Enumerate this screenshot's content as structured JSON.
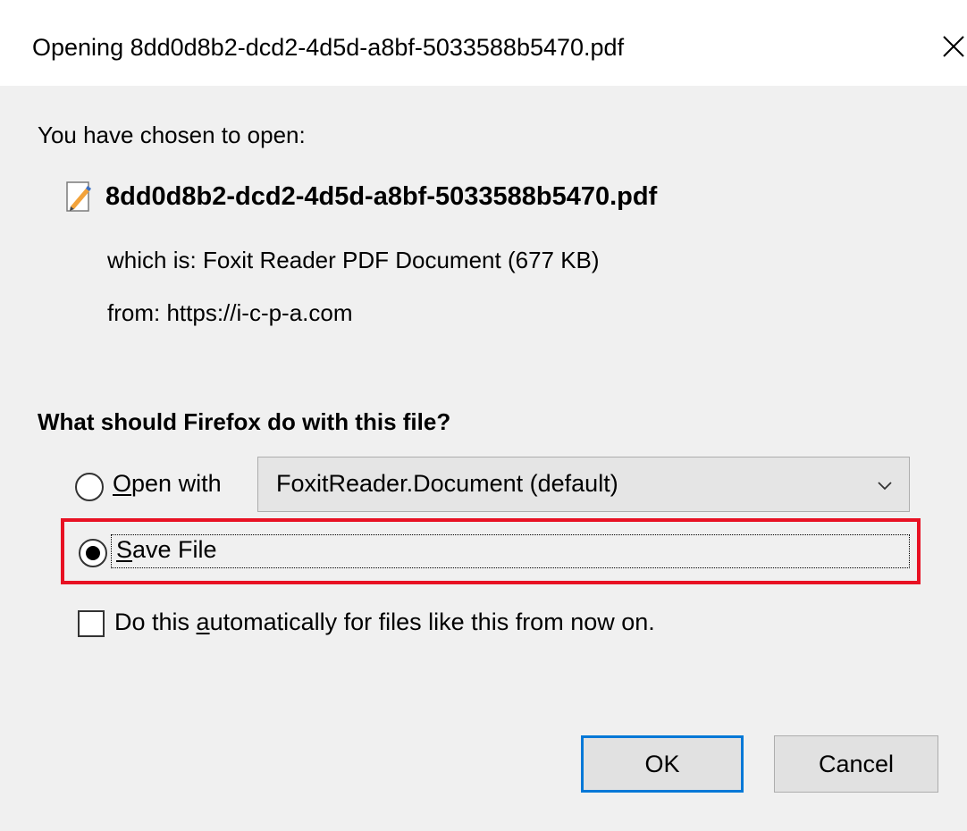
{
  "window": {
    "title": "Opening 8dd0d8b2-dcd2-4d5d-a8bf-5033588b5470.pdf",
    "close_icon": "close-icon"
  },
  "file_info": {
    "intro": "You have chosen to open:",
    "file_icon": "pdf-file-icon",
    "file_name": "8dd0d8b2-dcd2-4d5d-a8bf-5033588b5470.pdf",
    "which_is_label": "which is:",
    "which_is_value": "Foxit Reader PDF Document (677 KB)",
    "from_label": "from:",
    "from_value": "https://i-c-p-a.com"
  },
  "action": {
    "question": "What should Firefox do with this file?",
    "open_with": {
      "accesskey": "O",
      "label_rest": "pen with",
      "checked": false,
      "selected_app": "FoxitReader.Document (default)"
    },
    "save_file": {
      "accesskey": "S",
      "label_rest": "ave File",
      "checked": true
    },
    "auto": {
      "label_before": "Do this ",
      "accesskey": "a",
      "label_after": "utomatically for files like this from now on.",
      "checked": false
    }
  },
  "buttons": {
    "ok": "OK",
    "cancel": "Cancel"
  },
  "colors": {
    "highlight_border": "#e81123",
    "default_button_border": "#0078d7",
    "dialog_background": "#f0f0f0"
  }
}
